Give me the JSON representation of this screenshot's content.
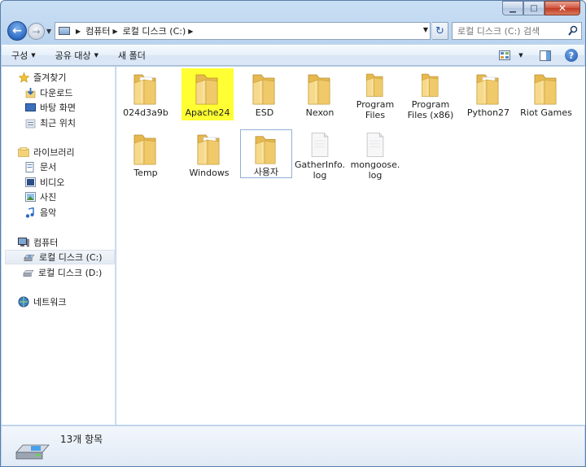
{
  "address": {
    "breadcrumbs": [
      "컴퓨터",
      "로컬 디스크 (C:)"
    ]
  },
  "search": {
    "placeholder": "로컬 디스크 (C:) 검색"
  },
  "toolbar": {
    "organize": "구성",
    "share": "공유 대상",
    "new_folder": "새 폴더"
  },
  "nav": {
    "favorites": "즐겨찾기",
    "downloads": "다운로드",
    "desktop": "바탕 화면",
    "recent": "최근 위치",
    "libraries": "라이브러리",
    "documents": "문서",
    "videos": "비디오",
    "pictures": "사진",
    "music": "음악",
    "computer": "컴퓨터",
    "drive_c": "로컬 디스크 (C:)",
    "drive_d": "로컬 디스크 (D:)",
    "network": "네트워크"
  },
  "files": [
    {
      "name": "024d3a9b",
      "line2": "",
      "type": "folder-doc"
    },
    {
      "name": "Apache24",
      "line2": "",
      "type": "folder",
      "highlight": true
    },
    {
      "name": "ESD",
      "line2": "",
      "type": "folder"
    },
    {
      "name": "Nexon",
      "line2": "",
      "type": "folder"
    },
    {
      "name": "Program",
      "line2": "Files",
      "type": "folder"
    },
    {
      "name": "Program",
      "line2": "Files (x86)",
      "type": "folder"
    },
    {
      "name": "Python27",
      "line2": "",
      "type": "folder-doc"
    },
    {
      "name": "Riot Games",
      "line2": "",
      "type": "folder"
    },
    {
      "name": "Temp",
      "line2": "",
      "type": "folder"
    },
    {
      "name": "Windows",
      "line2": "",
      "type": "folder-doc"
    },
    {
      "name": "사용자",
      "line2": "",
      "type": "folder",
      "focused": true
    },
    {
      "name": "GatherInfo.",
      "line2": "log",
      "type": "file"
    },
    {
      "name": "mongoose.",
      "line2": "log",
      "type": "file"
    }
  ],
  "status": {
    "count": "13개 항목"
  },
  "colors": {
    "highlight": "#ffff33",
    "folder": "#f3d27a",
    "accent": "#2c6ac2"
  }
}
